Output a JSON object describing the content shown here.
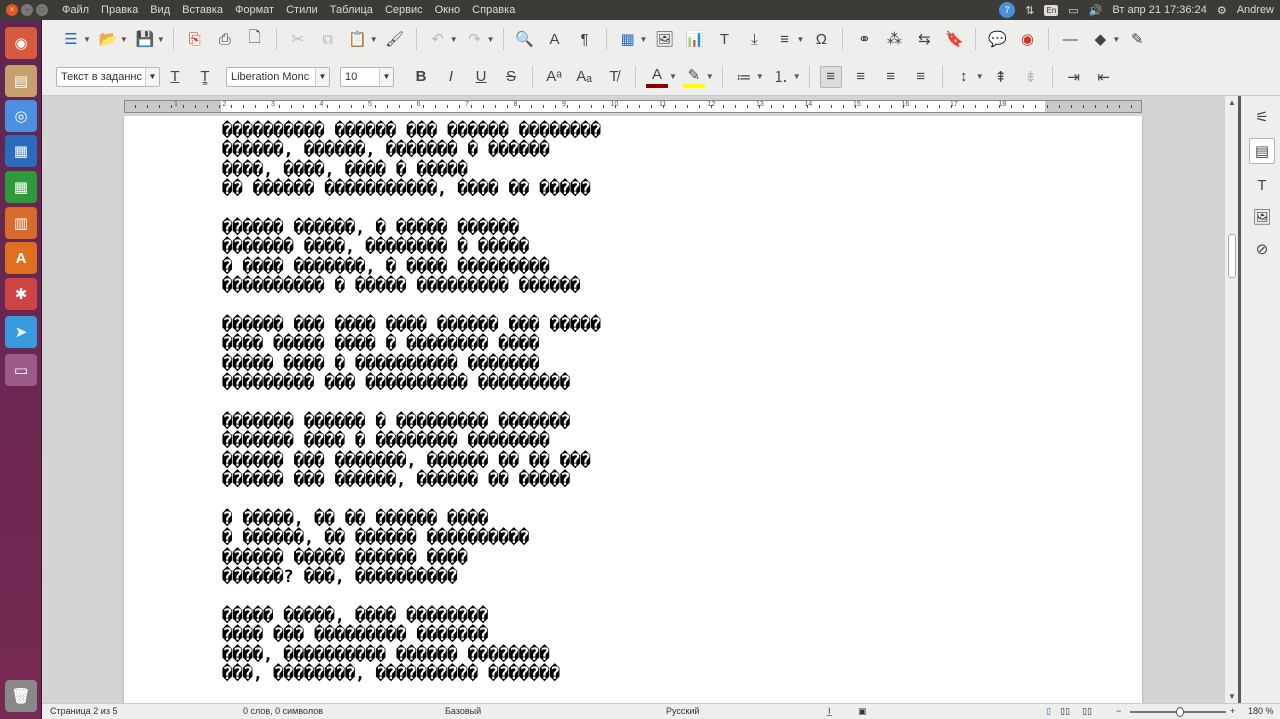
{
  "menubar": {
    "window_buttons": [
      "×",
      "–",
      "□"
    ],
    "items": [
      "Файл",
      "Правка",
      "Вид",
      "Вставка",
      "Формат",
      "Стили",
      "Таблица",
      "Сервис",
      "Окно",
      "Справка"
    ],
    "telegram_badge": "7",
    "lang": "En",
    "datetime": "Вт апр 21 17:36:24",
    "user": "Andrew",
    "icons": [
      "telegram-tray-icon",
      "network-icon",
      "keyboard-layout-icon",
      "battery-icon",
      "volume-icon",
      "gear-icon"
    ]
  },
  "launcher": {
    "apps": [
      {
        "name": "ubuntu-dash-icon",
        "glyph": "◉",
        "color": "#d85a3e"
      },
      {
        "name": "files-icon",
        "glyph": "▤",
        "color": "#c8a070"
      },
      {
        "name": "chromium-icon",
        "glyph": "◎",
        "color": "#4a8fe0"
      },
      {
        "name": "writer-icon",
        "glyph": "▦",
        "color": "#2a6bbd"
      },
      {
        "name": "calc-icon",
        "glyph": "▦",
        "color": "#2e9a3c"
      },
      {
        "name": "impress-icon",
        "glyph": "▥",
        "color": "#d86a2a"
      },
      {
        "name": "software-center-icon",
        "glyph": "A",
        "color": "#e07020"
      },
      {
        "name": "settings-icon",
        "glyph": "✱",
        "color": "#c44"
      },
      {
        "name": "telegram-icon",
        "glyph": "➤",
        "color": "#3a9adf"
      },
      {
        "name": "workspace-icon",
        "glyph": "▭",
        "color": "#9a5a8a"
      },
      {
        "name": "trash-icon",
        "glyph": "🗑",
        "color": "#888"
      }
    ]
  },
  "toolbar1": {
    "icons": [
      {
        "name": "sidebar-toggle-icon",
        "glyph": "☰"
      },
      {
        "name": "open-icon",
        "glyph": "📂"
      },
      {
        "name": "save-icon",
        "glyph": "💾"
      },
      {
        "name": "export-pdf-icon",
        "glyph": "⎘"
      },
      {
        "name": "print-icon",
        "glyph": "⎙"
      },
      {
        "name": "print-preview-icon",
        "glyph": "🗋"
      },
      {
        "name": "cut-icon",
        "glyph": "✂"
      },
      {
        "name": "copy-icon",
        "glyph": "⧉"
      },
      {
        "name": "paste-icon",
        "glyph": "📋"
      },
      {
        "name": "clone-format-icon",
        "glyph": "🖌"
      },
      {
        "name": "undo-icon",
        "glyph": "↶"
      },
      {
        "name": "redo-icon",
        "glyph": "↷"
      },
      {
        "name": "find-replace-icon",
        "glyph": "🔍"
      },
      {
        "name": "spelling-icon",
        "glyph": "A"
      },
      {
        "name": "formatting-marks-icon",
        "glyph": "¶"
      },
      {
        "name": "insert-table-icon",
        "glyph": "▦"
      },
      {
        "name": "insert-image-icon",
        "glyph": "🖼"
      },
      {
        "name": "insert-chart-icon",
        "glyph": "📊"
      },
      {
        "name": "insert-textbox-icon",
        "glyph": "T"
      },
      {
        "name": "page-break-icon",
        "glyph": "⤓"
      },
      {
        "name": "insert-field-icon",
        "glyph": "≡"
      },
      {
        "name": "special-character-icon",
        "glyph": "Ω"
      },
      {
        "name": "hyperlink-icon",
        "glyph": "⚭"
      },
      {
        "name": "footnote-icon",
        "glyph": "⁂"
      },
      {
        "name": "cross-reference-icon",
        "glyph": "⇆"
      },
      {
        "name": "bookmark-icon",
        "glyph": "🔖"
      },
      {
        "name": "comment-icon",
        "glyph": "💬"
      },
      {
        "name": "track-changes-icon",
        "glyph": "◉"
      },
      {
        "name": "insert-line-icon",
        "glyph": "—"
      },
      {
        "name": "basic-shapes-icon",
        "glyph": "◆"
      },
      {
        "name": "draw-icon",
        "glyph": "✎"
      }
    ]
  },
  "toolbar2": {
    "paragraph_style": "Текст в заданнс",
    "font_name": "Liberation Monc",
    "font_size": "10",
    "icons": [
      {
        "name": "bold-icon",
        "glyph": "B"
      },
      {
        "name": "italic-icon",
        "glyph": "I"
      },
      {
        "name": "underline-icon",
        "glyph": "U"
      },
      {
        "name": "strikethrough-icon",
        "glyph": "S"
      },
      {
        "name": "superscript-icon",
        "glyph": "Aᵃ"
      },
      {
        "name": "subscript-icon",
        "glyph": "Aₐ"
      },
      {
        "name": "clear-formatting-icon",
        "glyph": "T̸"
      },
      {
        "name": "font-color-icon",
        "glyph": "A"
      },
      {
        "name": "highlight-icon",
        "glyph": "✎"
      },
      {
        "name": "bullets-icon",
        "glyph": "≔"
      },
      {
        "name": "numbering-icon",
        "glyph": "⒈"
      },
      {
        "name": "align-left-icon",
        "glyph": "≡"
      },
      {
        "name": "align-center-icon",
        "glyph": "≡"
      },
      {
        "name": "align-right-icon",
        "glyph": "≡"
      },
      {
        "name": "justify-icon",
        "glyph": "≡"
      },
      {
        "name": "line-spacing-icon",
        "glyph": "↕"
      },
      {
        "name": "increase-paragraph-spacing-icon",
        "glyph": "⇞"
      },
      {
        "name": "decrease-paragraph-spacing-icon",
        "glyph": "⇟"
      },
      {
        "name": "increase-indent-icon",
        "glyph": "⇥"
      },
      {
        "name": "decrease-indent-icon",
        "glyph": "⇤"
      }
    ],
    "font_color": "#8b0000",
    "highlight_color": "#ffff00"
  },
  "ruler": {
    "labels": [
      "1",
      "2",
      "3",
      "4",
      "5",
      "6",
      "7",
      "8",
      "9",
      "10",
      "11",
      "12",
      "13",
      "14",
      "15",
      "16",
      "17",
      "18"
    ]
  },
  "document": {
    "stanzas": [
      [
        "���������� ������ ��� ������ ��������",
        "������, ������, ������� � ������",
        "����, ����, ���� � �����",
        "�� ������ �����������, ���� �� �����"
      ],
      [
        "������ ������, � ����� ������",
        "������� ����, �������� � �����",
        "� ���� �������, � ���� ���������",
        "���������� � ����� ��������� ������"
      ],
      [
        "������ ��� ���� ���� ������ ��� �����",
        "���� ����� ���� � �������� ����",
        "����� ���� � ���������� �������",
        "��������� ��� ���������� ���������"
      ],
      [
        "������� ������ � ��������� �������",
        "������� ���� � �������� ��������",
        "������ ��� �������, ������ �� �� ���",
        "������ ��� ������, ������ �� �����"
      ],
      [
        "� �����, �� �� ������ ����",
        "� ������, �� ������ ����������",
        "������ ����� ������ ����",
        "������? ���, ����������"
      ],
      [
        "����� �����, ���� ��������",
        "���� ��� ��������� �������",
        "����, ���������� ������ ��������",
        "���, ��������, ���������� �������"
      ]
    ]
  },
  "sidebar": {
    "icons": [
      "properties-icon",
      "styles-icon",
      "gallery-icon",
      "navigator-icon",
      "compass-icon"
    ]
  },
  "statusbar": {
    "page": "Страница 2 из 5",
    "words": "0 слов, 0 символов",
    "style": "Базовый",
    "language": "Русский",
    "zoom_minus": "−",
    "zoom_plus": "+",
    "zoom_level": "180 %"
  }
}
